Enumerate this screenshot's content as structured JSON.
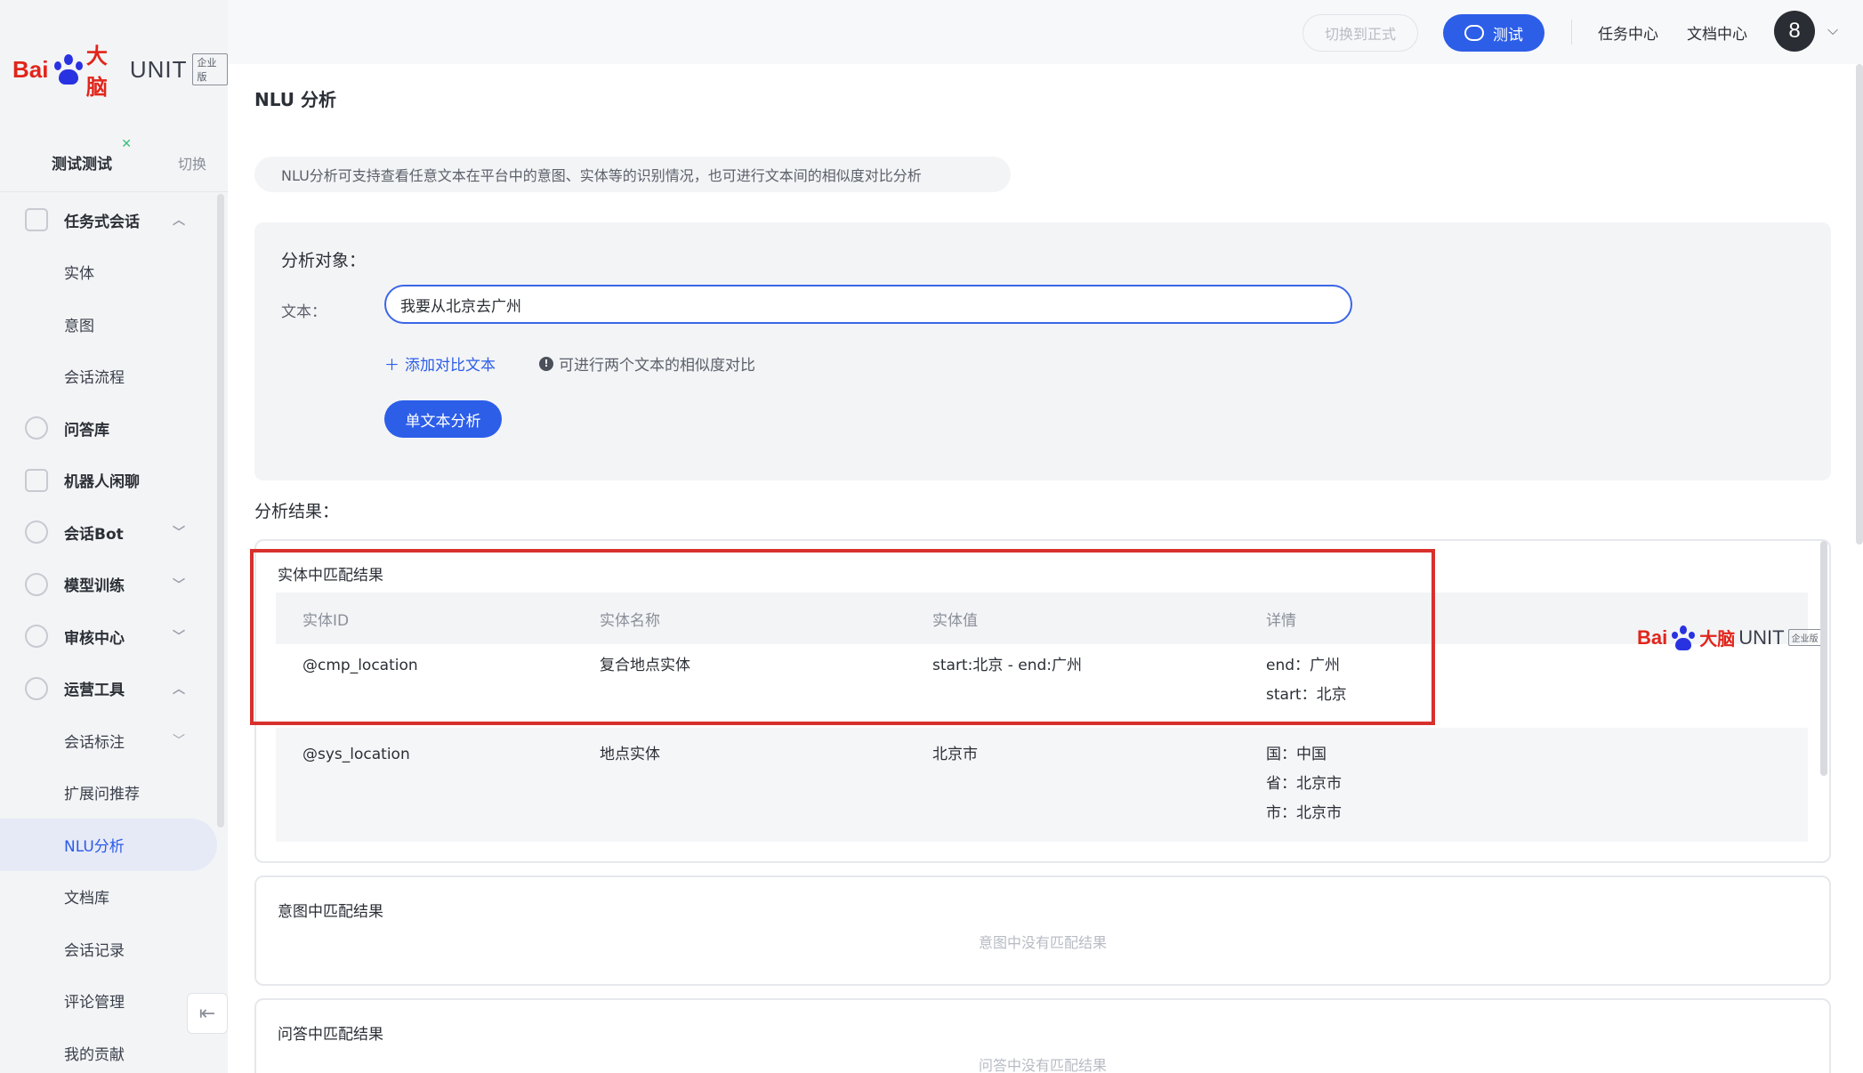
{
  "brand": {
    "bai": "Bai",
    "dana": "大脑",
    "unit": "UNIT",
    "edition": "企业版"
  },
  "workspace": {
    "name": "测试测试",
    "switch_label": "切换"
  },
  "sidebar": {
    "items": [
      {
        "label": "任务式会话",
        "type": "group",
        "icon": "task-dialog-icon",
        "chevron": "up"
      },
      {
        "label": "实体",
        "type": "sub"
      },
      {
        "label": "意图",
        "type": "sub"
      },
      {
        "label": "会话流程",
        "type": "sub"
      },
      {
        "label": "问答库",
        "type": "group",
        "icon": "question-icon"
      },
      {
        "label": "机器人闲聊",
        "type": "group",
        "icon": "chat-icon"
      },
      {
        "label": "会话Bot",
        "type": "group",
        "icon": "bot-icon",
        "chevron": "down"
      },
      {
        "label": "模型训练",
        "type": "group",
        "icon": "training-icon",
        "chevron": "down"
      },
      {
        "label": "审核中心",
        "type": "group",
        "icon": "shield-icon",
        "chevron": "down"
      },
      {
        "label": "运营工具",
        "type": "group",
        "icon": "tools-icon",
        "chevron": "up"
      },
      {
        "label": "会话标注",
        "type": "sub",
        "chevron": "down"
      },
      {
        "label": "扩展问推荐",
        "type": "sub"
      },
      {
        "label": "NLU分析",
        "type": "sub",
        "active": true
      },
      {
        "label": "文档库",
        "type": "sub"
      },
      {
        "label": "会话记录",
        "type": "sub"
      },
      {
        "label": "评论管理",
        "type": "sub"
      },
      {
        "label": "我的贡献",
        "type": "sub"
      }
    ]
  },
  "topbar": {
    "switch_prod": "切换到正式",
    "test": "测试",
    "task_center": "任务中心",
    "doc_center": "文档中心",
    "avatar": "8"
  },
  "page": {
    "title": "NLU 分析",
    "notice": "NLU分析可支持查看任意文本在平台中的意图、实体等的识别情况，也可进行文本间的相似度对比分析"
  },
  "analysis": {
    "target_label": "分析对象：",
    "text_label": "文本：",
    "text_value": "我要从北京去广州",
    "add_compare": "添加对比文本",
    "hint": "可进行两个文本的相似度对比",
    "analyze_button": "单文本分析"
  },
  "results": {
    "label": "分析结果：",
    "entity": {
      "title": "实体中匹配结果",
      "headers": [
        "实体ID",
        "实体名称",
        "实体值",
        "详情"
      ],
      "rows": [
        {
          "id": "@cmp_location",
          "name": "复合地点实体",
          "value": "start:北京 - end:广州",
          "details": [
            "end：广州",
            "start：北京"
          ]
        },
        {
          "id": "@sys_location",
          "name": "地点实体",
          "value": "北京市",
          "details": [
            "国：中国",
            "省：北京市",
            "市：北京市"
          ]
        }
      ]
    },
    "intent": {
      "title": "意图中匹配结果",
      "empty": "意图中没有匹配结果"
    },
    "qa": {
      "title": "问答中匹配结果",
      "empty": "问答中没有匹配结果"
    }
  },
  "colors": {
    "primary": "#2c5ee8",
    "brand_red": "#e1251b",
    "highlight_red": "#d8302c"
  }
}
